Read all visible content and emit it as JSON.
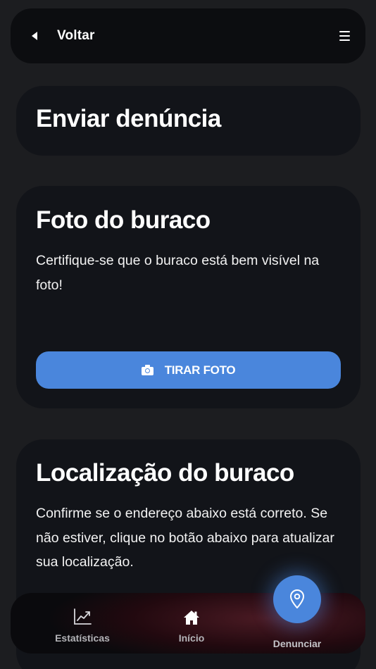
{
  "header": {
    "back_label": "Voltar",
    "back_icon": "back-arrow-icon",
    "menu_icon": "hamburger-menu-icon"
  },
  "page": {
    "title": "Enviar denúncia"
  },
  "photo_section": {
    "title": "Foto do buraco",
    "description": "Certifique-se que o buraco está bem visível na foto!",
    "button_label": "TIRAR FOTO",
    "button_icon": "camera-icon",
    "button_color": "#4a86dc"
  },
  "location_section": {
    "title": "Localização do buraco",
    "description": "Confirme se o endereço abaixo está correto. Se não estiver, clique no botão abaixo para atualizar sua localização."
  },
  "bottom_nav": {
    "items": [
      {
        "label": "Estatísticas",
        "icon": "chart-icon"
      },
      {
        "label": "Início",
        "icon": "home-icon"
      },
      {
        "label": "Denunciar",
        "icon": "location-pin-icon",
        "active": true
      }
    ],
    "active_color": "#4a86dc"
  },
  "colors": {
    "background": "#1c1d20",
    "card": "#121419",
    "header": "#0c0d10",
    "accent": "#4a86dc"
  }
}
